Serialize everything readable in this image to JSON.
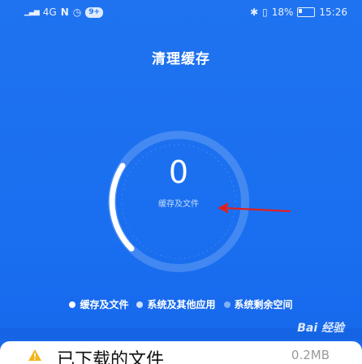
{
  "status_bar": {
    "signal": "4G",
    "badge": "9+",
    "battery_pct": "18%",
    "time": "15:26"
  },
  "header": {
    "title": "清理缓存"
  },
  "gauge": {
    "value": "0",
    "label": "缓存及文件"
  },
  "legend": [
    {
      "label": "缓存及文件",
      "color": "#ffffff"
    },
    {
      "label": "系统及其他应用",
      "color": "#cfe0ff"
    },
    {
      "label": "系统剩余空间",
      "color": "#7fb0f8"
    }
  ],
  "watermark": "Bai 经验",
  "card": {
    "title": "已下载的文件",
    "size": "0.2MB"
  },
  "colors": {
    "background": "#1f73f0",
    "annotation_arrow": "#e02020",
    "warning_icon": "#f2b51b"
  }
}
